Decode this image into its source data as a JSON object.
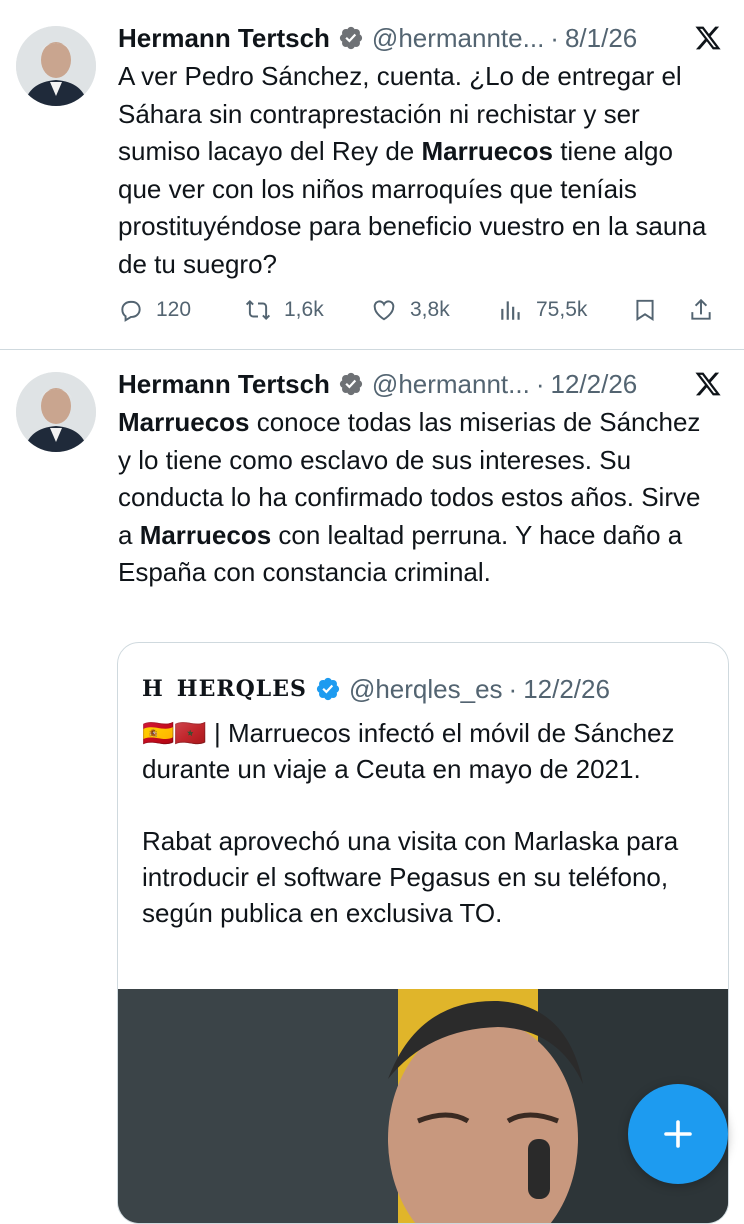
{
  "tweets": [
    {
      "author": "Hermann Tertsch",
      "handle": "@hermannte...",
      "date": "8/1/26",
      "text_parts": [
        {
          "text": "A ver Pedro Sánchez, cuenta. ¿Lo de entregar el Sáhara sin contraprestación ni rechistar y ser sumiso lacayo del Rey de ",
          "bold": false
        },
        {
          "text": "Marruecos",
          "bold": true
        },
        {
          "text": " tiene algo que ver con los niños marroquíes que teníais prostituyéndose para beneficio vuestro en la sauna de tu suegro?",
          "bold": false
        }
      ],
      "replies": "120",
      "reposts": "1,6k",
      "likes": "3,8k",
      "views": "75,5k"
    },
    {
      "author": "Hermann Tertsch",
      "handle": "@hermannt...",
      "date": "12/2/26",
      "text_parts": [
        {
          "text": "Marruecos",
          "bold": true
        },
        {
          "text": " conoce todas las miserias de Sánchez y lo tiene como esclavo de sus intereses. Su conducta lo ha confirmado todos estos años. Sirve a ",
          "bold": false
        },
        {
          "text": "Marruecos",
          "bold": true
        },
        {
          "text": " con lealtad perruna. Y hace daño a España con constancia criminal.",
          "bold": false
        }
      ],
      "quote": {
        "logo": "H",
        "name": "HERQLES",
        "handle": "@herqles_es",
        "date": "12/2/26",
        "flags": "🇪🇸🇲🇦",
        "line1": " | Marruecos infectó el móvil de Sánchez durante un viaje a Ceuta en mayo de 2021.",
        "line2": "Rabat aprovechó una visita con Marlaska para introducir el software Pegasus en su teléfono, según publica en exclusiva TO."
      }
    }
  ],
  "separator_dot": "·",
  "icons": {
    "verified": "verified-badge-icon",
    "x": "x-logo-icon",
    "reply": "reply-icon",
    "repost": "repost-icon",
    "like": "heart-icon",
    "views": "views-icon",
    "bookmark": "bookmark-icon",
    "share": "share-icon",
    "compose": "plus-icon"
  },
  "colors": {
    "accent": "#1d9bf0",
    "verified": "#6e7175",
    "secondary_text": "#536471",
    "border": "#cfd9de"
  }
}
